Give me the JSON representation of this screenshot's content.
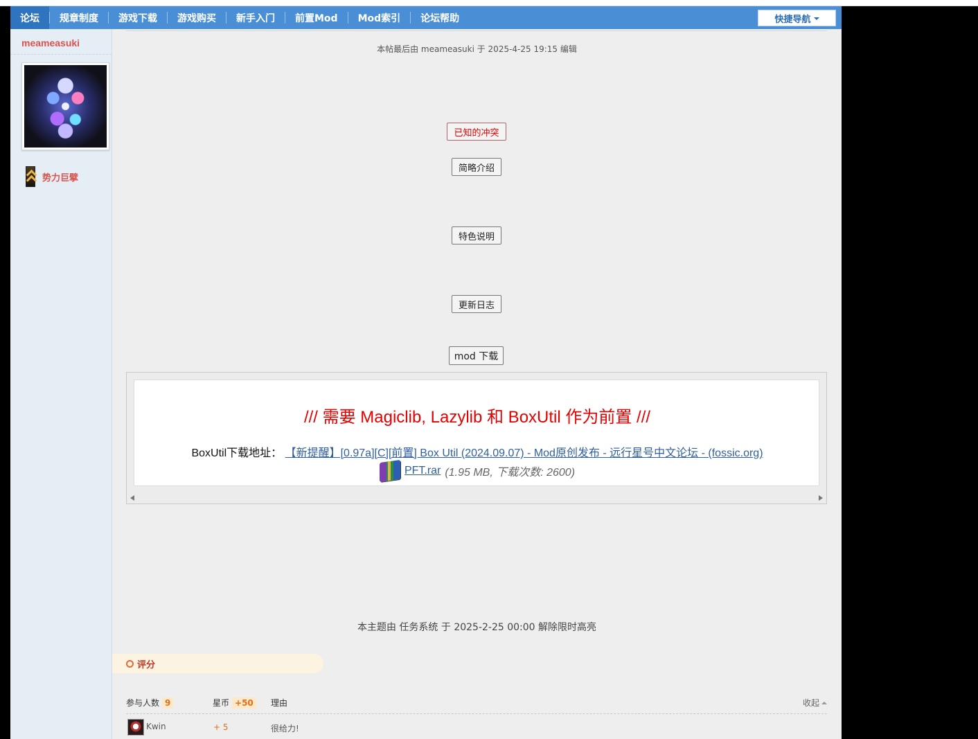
{
  "nav": {
    "items": [
      {
        "label": "论坛",
        "active": true
      },
      {
        "label": "规章制度"
      },
      {
        "label": "游戏下载"
      },
      {
        "label": "游戏购买"
      },
      {
        "label": "新手入门"
      },
      {
        "label": "前置Mod"
      },
      {
        "label": "Mod索引"
      },
      {
        "label": "论坛帮助"
      }
    ],
    "quick_nav": "快捷导航"
  },
  "user": {
    "name": "meameasuki",
    "rank": "势力巨擘"
  },
  "post": {
    "edit_note": "本帖最后由 meameasuki 于 2025-4-25 19:15 编辑",
    "buttons": {
      "conflicts": "已知的冲突",
      "intro": "简略介绍",
      "features": "特色说明",
      "changelog": "更新日志",
      "download": "mod 下载"
    },
    "requirement": "/// 需要 Magiclib, Lazylib 和 BoxUtil 作为前置 ///",
    "boxutil_label": "BoxUtil下载地址：",
    "boxutil_link": "【新提醒】[0.97a][C][前置] Box Util (2024.09.07) - Mod原创发布 - 远行星号中文论坛 - (fossic.org)",
    "attachment": {
      "name": "PFT.rar",
      "meta": "(1.95 MB, 下载次数: 2600)"
    },
    "highlight_note": "本主题由 任务系统 于 2025-2-25 00:00 解除限时高亮"
  },
  "rating": {
    "tab_label": "评分",
    "participants_label": "参与人数",
    "participants_count": "9",
    "coins_label": "星币",
    "coins_total": "+50",
    "reason_label": "理由",
    "collapse_label": "收起",
    "rows": [
      {
        "user": "Kwin",
        "amount": "+ 5",
        "reason": "很给力!"
      }
    ]
  },
  "colors": {
    "nav_bg": "#4a8fd6",
    "nav_active": "#2f74bf",
    "username": "#d9534f",
    "requirement_text": "#e60000",
    "link": "#2f5fa0",
    "coin": "#e0701e"
  }
}
